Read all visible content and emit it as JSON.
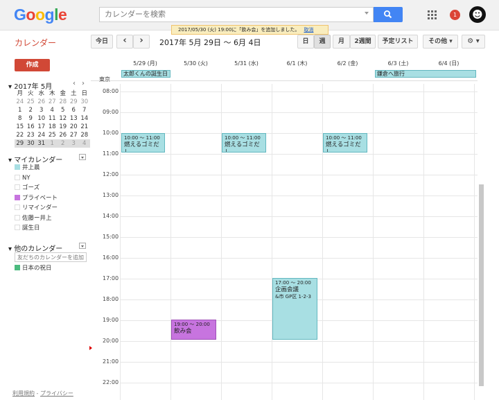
{
  "header": {
    "logo": "Google",
    "search_placeholder": "カレンダーを検索",
    "notification_count": "1"
  },
  "toast": {
    "message": "2017/05/30 (火) 19:00に「飲み会」を追加しました。",
    "undo": "取消"
  },
  "app_title": "カレンダー",
  "toolbar": {
    "today": "今日",
    "prev": "‹",
    "next": "›",
    "date_range": "2017年 5月 29日 ～ 6月 4日",
    "views": [
      "日",
      "週",
      "月",
      "2週間",
      "予定リスト"
    ],
    "selected_view": "週",
    "more": "その他 ▾",
    "settings": "⚙ ▾"
  },
  "create_button": "作成",
  "mini_calendar": {
    "title": "2017年 5月",
    "prev": "‹",
    "next": "›",
    "weekdays": [
      "月",
      "火",
      "水",
      "木",
      "金",
      "土",
      "日"
    ],
    "weeks": [
      [
        "24",
        "25",
        "26",
        "27",
        "28",
        "29",
        "30"
      ],
      [
        "1",
        "2",
        "3",
        "4",
        "5",
        "6",
        "7"
      ],
      [
        "8",
        "9",
        "10",
        "11",
        "12",
        "13",
        "14"
      ],
      [
        "15",
        "16",
        "17",
        "18",
        "19",
        "20",
        "21"
      ],
      [
        "22",
        "23",
        "24",
        "25",
        "26",
        "27",
        "28"
      ],
      [
        "29",
        "30",
        "31",
        "1",
        "2",
        "3",
        "4"
      ]
    ]
  },
  "my_calendars": {
    "title": "マイカレンダー",
    "items": [
      {
        "label": "井上晨",
        "color": "#a8dfe3"
      },
      {
        "label": "NY",
        "color": ""
      },
      {
        "label": "ゴーズ",
        "color": ""
      },
      {
        "label": "プライベート",
        "color": "#c774df"
      },
      {
        "label": "リマインダー",
        "color": ""
      },
      {
        "label": "佐藤ー井上",
        "color": ""
      },
      {
        "label": "誕生日",
        "color": ""
      }
    ]
  },
  "other_calendars": {
    "title": "他のカレンダー",
    "add_placeholder": "友だちのカレンダーを追加",
    "items": [
      {
        "label": "日本の祝日",
        "color": "#4cbb7f"
      }
    ]
  },
  "footer": {
    "terms": "利用規約",
    "sep": " - ",
    "privacy": "プライバシー"
  },
  "week": {
    "timezone": "東京",
    "days": [
      "5/29 (月)",
      "5/30 (火)",
      "5/31 (水)",
      "6/1 (木)",
      "6/2 (金)",
      "6/3 (土)",
      "6/4 (日)"
    ],
    "hours": [
      "08:00",
      "09:00",
      "10:00",
      "11:00",
      "12:00",
      "13:00",
      "14:00",
      "15:00",
      "16:00",
      "17:00",
      "18:00",
      "19:00",
      "20:00",
      "21:00",
      "22:00"
    ],
    "allday_events": [
      {
        "title": "太郎くんの誕生日"
      },
      {
        "title": "鎌倉へ旅行"
      }
    ],
    "events": [
      {
        "time": "10:00 ～ 11:00",
        "title": "燃えるゴミだし",
        "location": ""
      },
      {
        "time": "10:00 ～ 11:00",
        "title": "燃えるゴミだし",
        "location": ""
      },
      {
        "time": "10:00 ～ 11:00",
        "title": "燃えるゴミだし",
        "location": ""
      },
      {
        "time": "19:00 ～ 20:00",
        "title": "飲み会",
        "location": ""
      },
      {
        "time": "17:00 ～ 20:00",
        "title": "企画会議",
        "location": "&市 GP区 1-2-3"
      }
    ]
  }
}
